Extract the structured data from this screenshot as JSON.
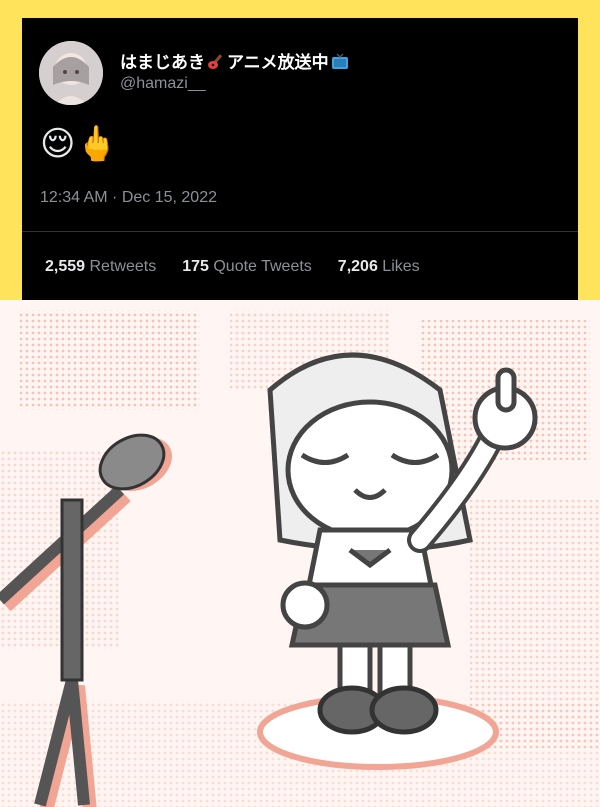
{
  "tweet": {
    "display_name_text": "はまじあき",
    "display_name_suffix": "アニメ放送中",
    "display_name_icons": [
      "guitar-emoji",
      "tv-emoji"
    ],
    "handle": "@hamazi__",
    "text_emojis": [
      "😌",
      "🖕"
    ],
    "timestamp": "12:34 AM · Dec 15, 2022",
    "stats": {
      "retweets": {
        "count": "2,559",
        "label": "Retweets"
      },
      "quote_tweets": {
        "count": "175",
        "label": "Quote Tweets"
      },
      "likes": {
        "count": "7,206",
        "label": "Likes"
      }
    }
  },
  "colors": {
    "frame_background": "#ffe35a",
    "card_background": "#000000",
    "illustration_background": "#fff5f2",
    "illustration_accent": "#f4b7a8"
  }
}
